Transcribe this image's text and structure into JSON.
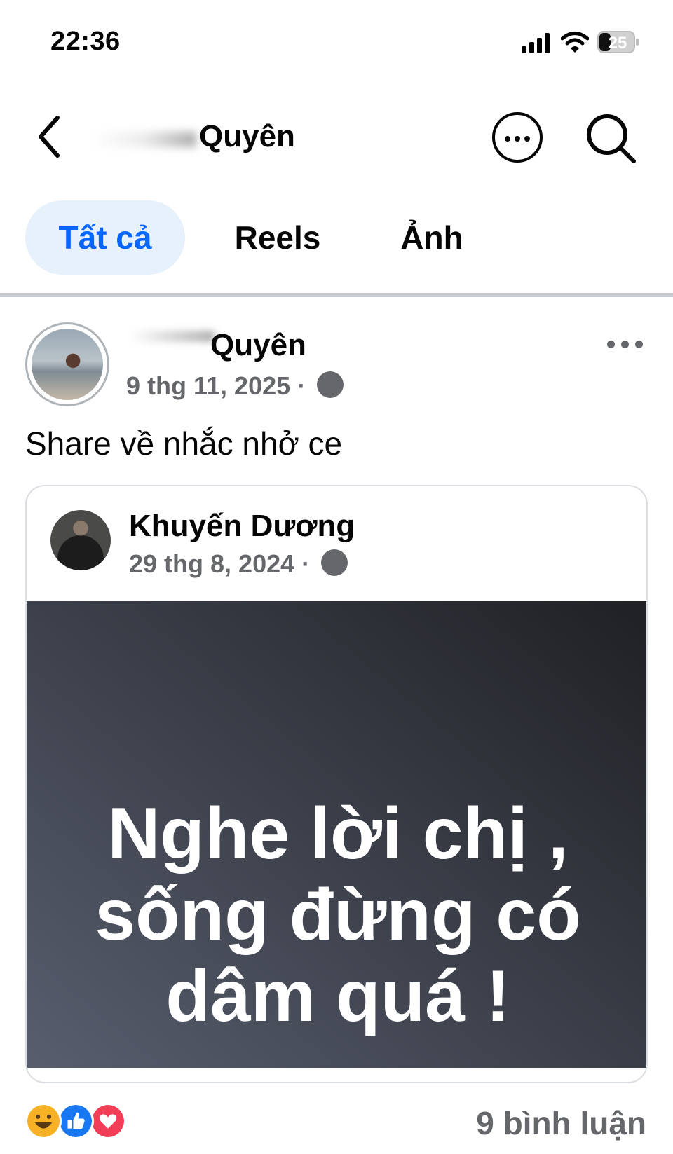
{
  "status_bar": {
    "time": "22:36",
    "battery": "25",
    "icons": [
      "signal-icon",
      "wifi-icon",
      "battery-icon"
    ]
  },
  "header": {
    "title": "Quyên",
    "icons": [
      "chevron-left-icon",
      "more-circle-icon",
      "search-icon"
    ]
  },
  "tabs": [
    {
      "label": "Tất cả",
      "active": true
    },
    {
      "label": "Reels",
      "active": false
    },
    {
      "label": "Ảnh",
      "active": false
    }
  ],
  "post": {
    "author": "Quyên",
    "date": "9 thg 11, 2025",
    "separator": "·",
    "privacy_icon": "globe-icon",
    "options_icon": "more-horizontal-icon",
    "text": "Share về nhắc nhở ce",
    "shared": {
      "author": "Khuyến Dương",
      "date": "29 thg 8, 2024",
      "separator": "·",
      "privacy_icon": "globe-icon",
      "quote_lines": [
        "Nghe lời chị ,",
        "sống đừng có",
        "dâm quá !"
      ],
      "background_colors": [
        "#585e6e",
        "#3b3f49",
        "#1f2024"
      ]
    }
  },
  "footer": {
    "reactions": [
      "haha-icon",
      "like-icon",
      "love-icon"
    ],
    "comments": "9 bình luận"
  },
  "colors": {
    "accent": "#0866ff",
    "tab_active_bg": "#e6f1fc",
    "secondary_text": "#65676b"
  }
}
